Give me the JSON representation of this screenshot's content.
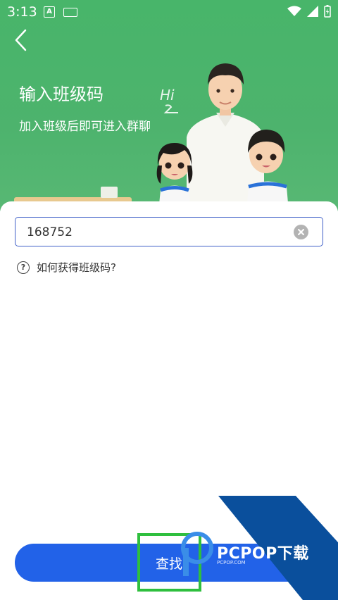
{
  "status_bar": {
    "time": "3:13",
    "notif_letter": "A"
  },
  "header": {
    "title": "输入班级码",
    "subtitle": "加入班级后即可进入群聊",
    "bubble": "Hi"
  },
  "form": {
    "class_code_value": "168752",
    "help_text": "如何获得班级码?",
    "search_label": "查找"
  },
  "watermark": {
    "brand": "PCPOP下载",
    "small": "PCPOP.COM"
  },
  "colors": {
    "header_green": "#4db36d",
    "input_border": "#4060c8",
    "button_blue": "#2262e8",
    "highlight_green": "#2fbf3e"
  }
}
